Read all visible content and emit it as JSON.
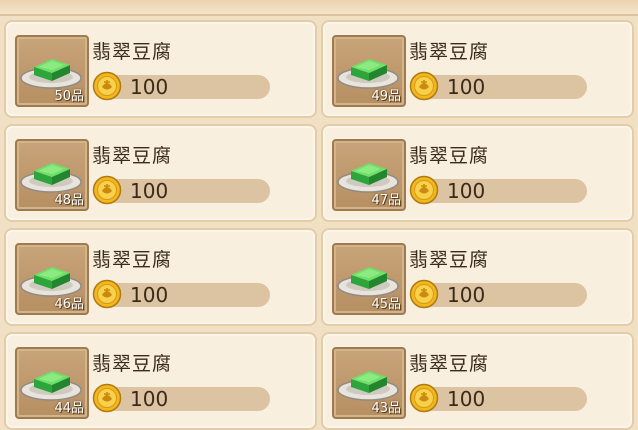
{
  "items": [
    {
      "name": "翡翠豆腐",
      "quality": "50品",
      "price": "100"
    },
    {
      "name": "翡翠豆腐",
      "quality": "49品",
      "price": "100"
    },
    {
      "name": "翡翠豆腐",
      "quality": "48品",
      "price": "100"
    },
    {
      "name": "翡翠豆腐",
      "quality": "47品",
      "price": "100"
    },
    {
      "name": "翡翠豆腐",
      "quality": "46品",
      "price": "100"
    },
    {
      "name": "翡翠豆腐",
      "quality": "45品",
      "price": "100"
    },
    {
      "name": "翡翠豆腐",
      "quality": "44品",
      "price": "100"
    },
    {
      "name": "翡翠豆腐",
      "quality": "43品",
      "price": "100"
    }
  ],
  "colors": {
    "card_bg": "#f8efde",
    "thumb_bg": "#b68f62",
    "tofu_green": "#3fc44a",
    "coin_gold": "#f2b61e"
  },
  "icons": {
    "dish": "jade-tofu-dish-icon",
    "currency": "gold-coin-icon"
  }
}
